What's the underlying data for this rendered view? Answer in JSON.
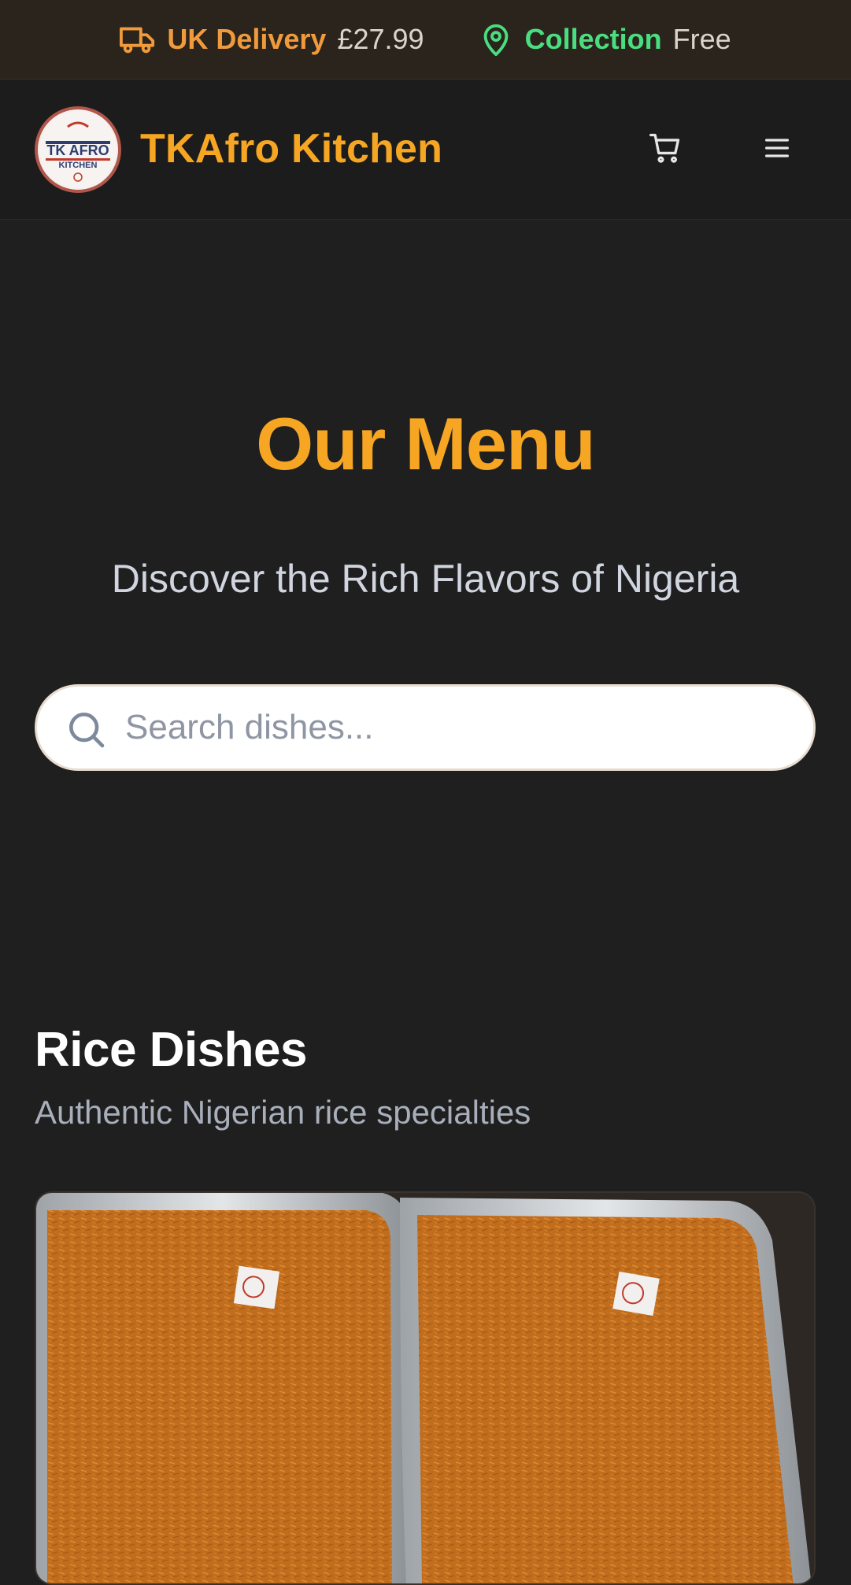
{
  "topbar": {
    "delivery_label": "UK Delivery",
    "delivery_price": "£27.99",
    "collection_label": "Collection",
    "collection_price": "Free",
    "delivery_icon": "truck-icon",
    "collection_icon": "map-pin-icon"
  },
  "navbar": {
    "brand": "TKAfro Kitchen",
    "cart_icon": "shopping-cart-icon",
    "menu_icon": "hamburger-menu-icon"
  },
  "hero": {
    "title": "Our Menu",
    "subtitle": "Discover the Rich Flavors of Nigeria"
  },
  "search": {
    "placeholder": "Search dishes...",
    "value": ""
  },
  "section": {
    "title": "Rice Dishes",
    "subtitle": "Authentic Nigerian rice specialties"
  },
  "colors": {
    "accent_orange": "#f6a623",
    "accent_green": "#4ade80",
    "background": "#1f1f1f"
  }
}
